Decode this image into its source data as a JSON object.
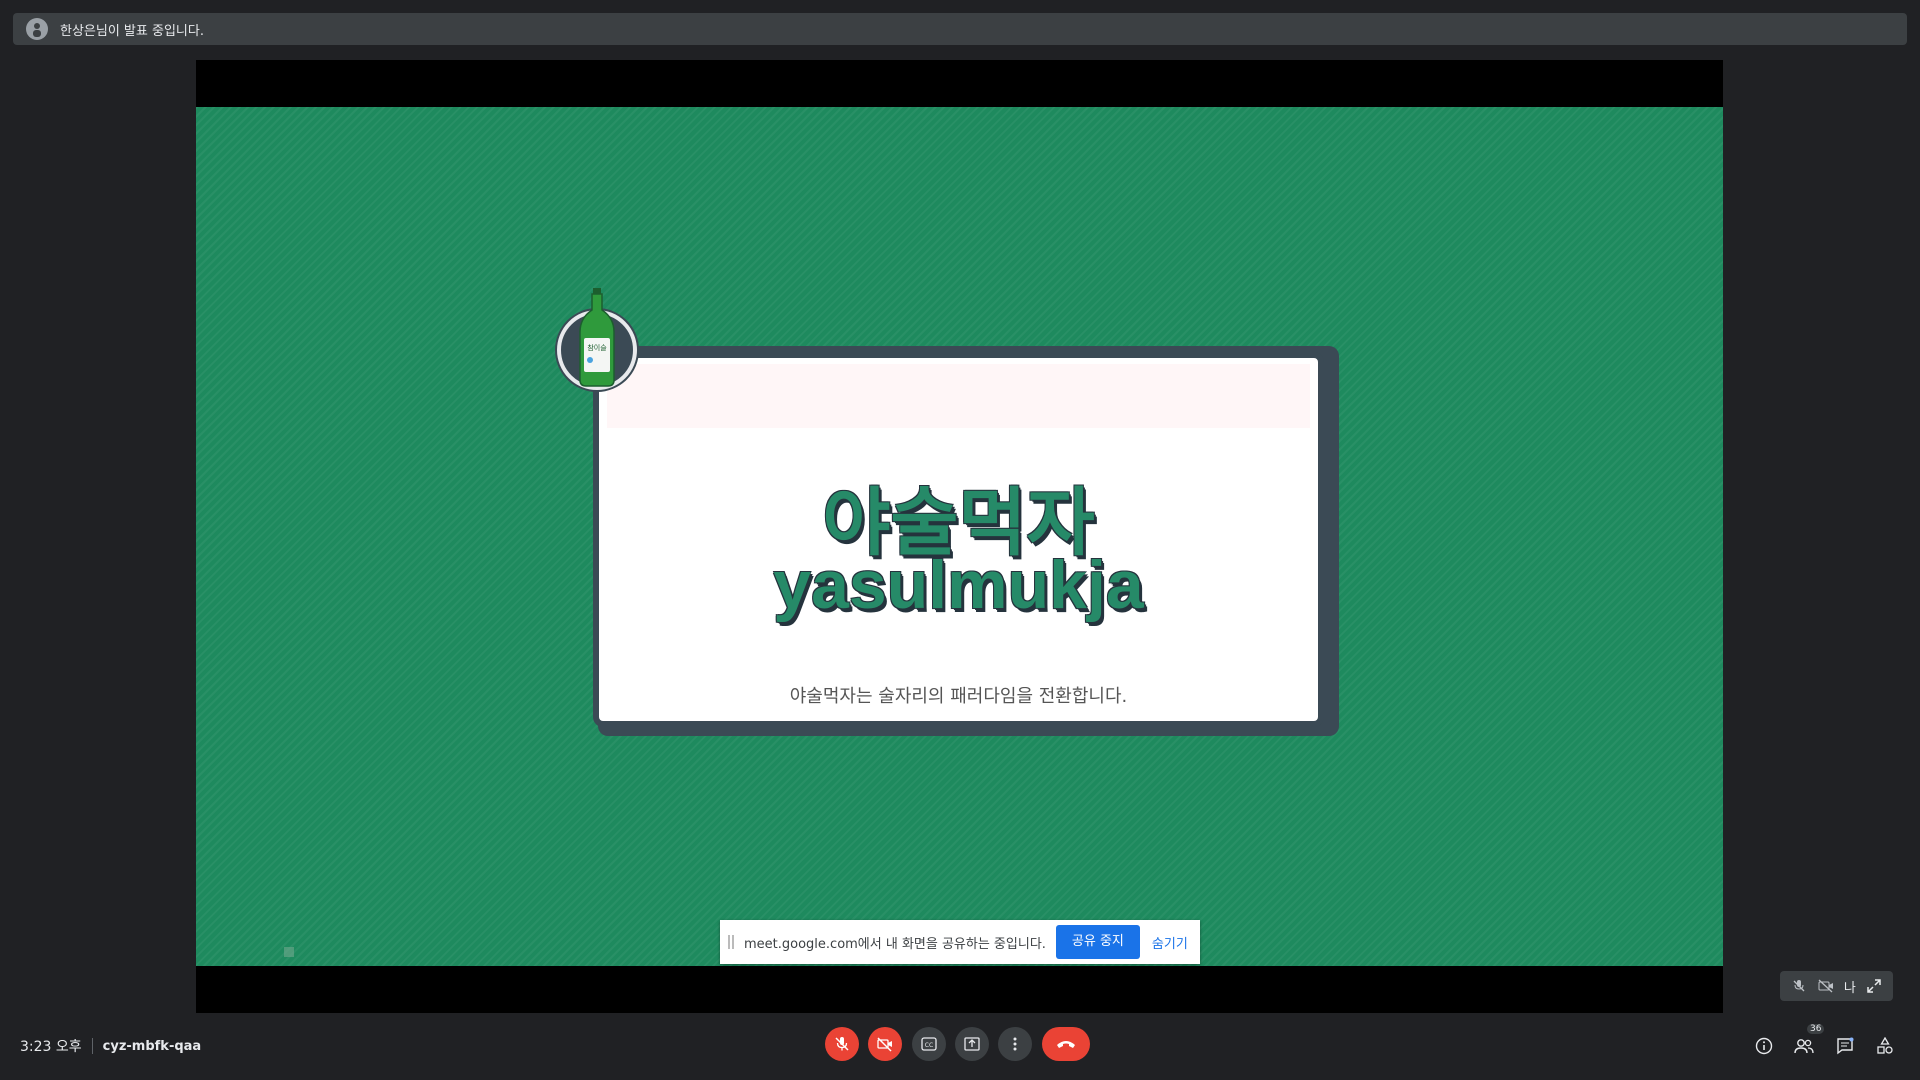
{
  "banner": {
    "presenter_text": "한상은님이 발표 중입니다.",
    "icon": "avatar"
  },
  "slide": {
    "title_ko": "야술먹자",
    "title_en": "yasulmukja",
    "subtitle": "야술먹자는 술자리의 패러다임을 전환합니다.",
    "logo_icon": "soju-bottle",
    "bottle_label": "참이슬",
    "background_color": "#1e8a5e",
    "title_color": "#268a68"
  },
  "share_notice": {
    "message": "meet.google.com에서 내 화면을 공유하는 중입니다.",
    "stop_label": "공유 중지",
    "hide_label": "숨기기"
  },
  "self_tile": {
    "label": "나",
    "icons": [
      "mic-off-icon",
      "camera-off-icon",
      "expand-icon"
    ]
  },
  "meeting": {
    "time": "3:23 오후",
    "code": "cyz-mbfk-qaa"
  },
  "controls": {
    "mic": "mic-off-icon",
    "camera": "camera-off-icon",
    "captions": "captions-icon",
    "present": "present-screen-icon",
    "more": "more-options-icon",
    "leave": "hang-up-icon"
  },
  "right_controls": {
    "participants_count": "36",
    "icons": [
      "info-icon",
      "people-icon",
      "chat-icon",
      "activities-icon"
    ]
  },
  "colors": {
    "accent_blue": "#1a73e8",
    "danger_red": "#ea4335",
    "surface": "#3c4043",
    "background": "#202124"
  }
}
